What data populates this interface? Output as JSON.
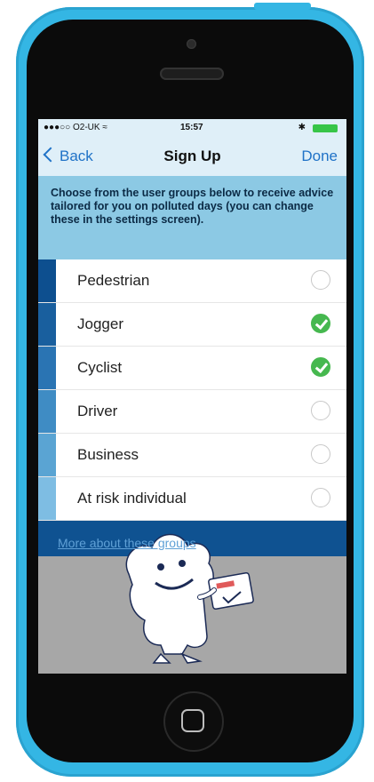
{
  "status_bar": {
    "carrier": "●●●○○ O2-UK ≈",
    "time": "15:57",
    "bluetooth": "✱"
  },
  "nav": {
    "back_label": "Back",
    "title": "Sign Up",
    "done_label": "Done"
  },
  "intro_text": "Choose from the user groups below to receive advice tailored for you on polluted days (you can change these in the settings screen).",
  "groups": [
    {
      "label": "Pedestrian",
      "selected": false,
      "stripe_color": "#0d4f8f"
    },
    {
      "label": "Jogger",
      "selected": true,
      "stripe_color": "#195f9e"
    },
    {
      "label": "Cyclist",
      "selected": true,
      "stripe_color": "#2a74b3"
    },
    {
      "label": "Driver",
      "selected": false,
      "stripe_color": "#3f8cc4"
    },
    {
      "label": "Business",
      "selected": false,
      "stripe_color": "#5aa4d3"
    },
    {
      "label": "At risk individual",
      "selected": false,
      "stripe_color": "#7ebde3"
    }
  ],
  "more_link": "More about these groups",
  "colors": {
    "phone_shell": "#34b6e4",
    "accent_blue": "#1f72c7",
    "check_green": "#46b84f",
    "band_blue": "#0f5291"
  },
  "icons": {
    "back": "chevron-left-icon",
    "check": "checkmark-circle-icon",
    "mascot": "cloud-mascot-illustration"
  }
}
